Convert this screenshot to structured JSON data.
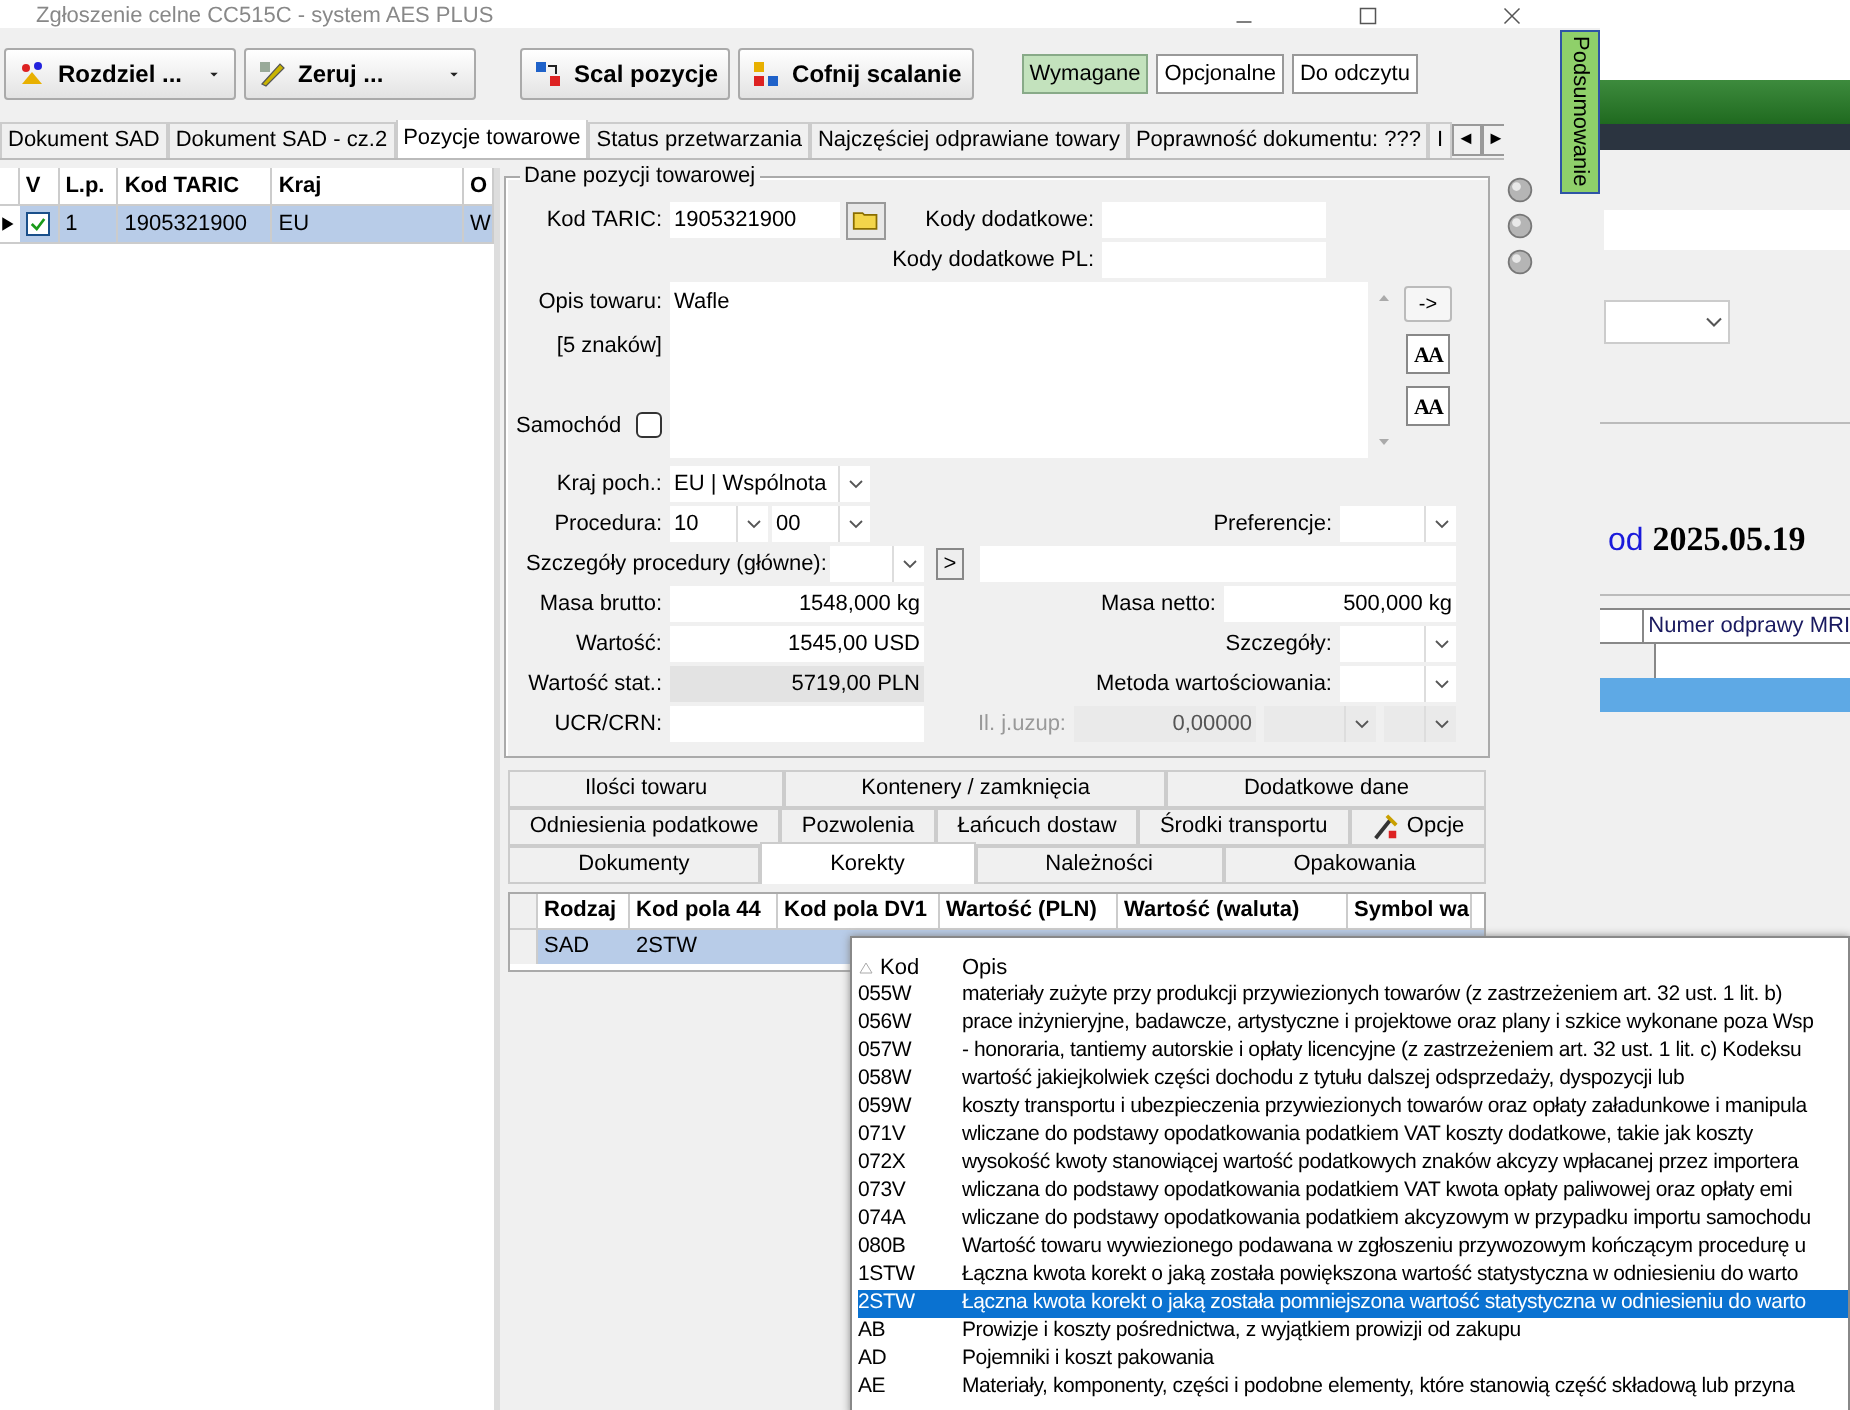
{
  "window": {
    "title": "Zgłoszenie celne CC515C - system AES PLUS"
  },
  "toolbar": {
    "buttons": [
      {
        "label": "Rozdziel ...",
        "kind": "split"
      },
      {
        "label": "Zeruj ...",
        "kind": "split"
      },
      {
        "label": "Scal pozycje",
        "kind": "plain"
      },
      {
        "label": "Cofnij scalanie",
        "kind": "plain"
      }
    ],
    "filters": [
      {
        "label": "Wymagane",
        "selected": true
      },
      {
        "label": "Opcjonalne",
        "selected": false
      },
      {
        "label": "Do odczytu",
        "selected": false
      }
    ]
  },
  "tabs": [
    {
      "label": "Dokument SAD",
      "selected": false
    },
    {
      "label": "Dokument SAD - cz.2",
      "selected": false
    },
    {
      "label": "Pozycje towarowe",
      "selected": true
    },
    {
      "label": "Status przetwarzania",
      "selected": false
    },
    {
      "label": "Najczęściej odprawiane towary",
      "selected": false
    },
    {
      "label": "Poprawność dokumentu: ???",
      "selected": false
    },
    {
      "label": "I",
      "selected": false
    }
  ],
  "tab_scroll": [
    "◄",
    "►"
  ],
  "items_table": {
    "check_column": "V",
    "columns": [
      "L.p.",
      "Kod TARIC",
      "Kraj",
      "O"
    ],
    "rows": [
      {
        "selected": true,
        "checked": true,
        "cells": [
          "1",
          "1905321900",
          "EU",
          "W"
        ]
      }
    ]
  },
  "form": {
    "title": "Dane pozycji towarowej",
    "kod_taric": {
      "label": "Kod TARIC:",
      "value": "1905321900"
    },
    "kody_dodatkowe": {
      "label": "Kody dodatkowe:"
    },
    "kody_dodatkowe_pl": {
      "label": "Kody dodatkowe PL:"
    },
    "opis": {
      "label": "Opis towaru:",
      "count": "[5 znaków]",
      "value": "Wafle"
    },
    "samochod": {
      "label": "Samochód",
      "checked": false
    },
    "side_buttons": [
      "->",
      "AA",
      "AA"
    ],
    "kraj": {
      "label": "Kraj poch.:",
      "value": "EU | Wspólnota"
    },
    "procedura": {
      "label": "Procedura:",
      "values": [
        "10",
        "00"
      ]
    },
    "preferencje": {
      "label": "Preferencje:"
    },
    "szczegoly_procedury": {
      "label": "Szczegóły procedury (główne):",
      "button": ">"
    },
    "masa_brutto": {
      "label": "Masa brutto:",
      "value": "1548,000 kg"
    },
    "masa_netto": {
      "label": "Masa netto:",
      "value": "500,000 kg"
    },
    "wartosc": {
      "label": "Wartość:",
      "value": "1545,00 USD"
    },
    "szczegoly": {
      "label": "Szczegóły:"
    },
    "wartosc_stat": {
      "label": "Wartość stat.:",
      "value": "5719,00 PLN"
    },
    "metoda": {
      "label": "Metoda wartościowania:"
    },
    "ucr": {
      "label": "UCR/CRN:"
    },
    "il_uzup": {
      "label": "Il. j.uzup:",
      "value": "0,00000",
      "disabled": true
    }
  },
  "bottom_tabs": [
    [
      {
        "label": "Ilości towaru",
        "selected": false
      },
      {
        "label": "Kontenery / zamknięcia",
        "selected": false
      },
      {
        "label": "Dodatkowe dane",
        "selected": false
      }
    ],
    [
      {
        "label": "Odniesienia podatkowe",
        "selected": false
      },
      {
        "label": "Pozwolenia",
        "selected": false
      },
      {
        "label": "Łańcuch dostaw",
        "selected": false
      },
      {
        "label": "Środki transportu",
        "selected": false
      },
      {
        "label": "Opcje",
        "selected": false,
        "icon": true
      }
    ],
    [
      {
        "label": "Dokumenty",
        "selected": false
      },
      {
        "label": "Korekty",
        "selected": true
      },
      {
        "label": "Należności",
        "selected": false
      },
      {
        "label": "Opakowania",
        "selected": false
      }
    ]
  ],
  "korekty_table": {
    "columns": [
      "Rodzaj",
      "Kod pola 44",
      "Kod pola DV1",
      "Wartość (PLN)",
      "Wartość (waluta)",
      "Symbol wa"
    ],
    "rows": [
      {
        "selected": true,
        "cells": [
          "SAD",
          "2STW"
        ]
      }
    ]
  },
  "side_tab": "Podsumowanie",
  "background_window": {
    "date_text": "od **2025.05.19**",
    "table_column": "Numer odprawy MRI"
  },
  "code_list": {
    "columns": [
      "Kod",
      "Opis"
    ],
    "rows": [
      {
        "code": "055W",
        "text": "materiały zużyte przy produkcji przywiezionych towarów (z zastrzeżeniem art. 32 ust. 1 lit. b)",
        "selected": false
      },
      {
        "code": "056W",
        "text": "prace inżynieryjne, badawcze, artystyczne i projektowe oraz plany i szkice wykonane poza Wsp",
        "selected": false
      },
      {
        "code": "057W",
        "text": "- honoraria, tantiemy autorskie i opłaty licencyjne (z zastrzeżeniem art. 32 ust. 1 lit. c) Kodeksu",
        "selected": false
      },
      {
        "code": "058W",
        "text": "wartość jakiejkolwiek części dochodu z tytułu dalszej odsprzedaży, dyspozycji lub",
        "selected": false
      },
      {
        "code": "059W",
        "text": "koszty transportu i ubezpieczenia przywiezionych towarów oraz opłaty załadunkowe i manipula",
        "selected": false
      },
      {
        "code": "071V",
        "text": "wliczane do podstawy opodatkowania podatkiem VAT koszty dodatkowe, takie jak koszty",
        "selected": false
      },
      {
        "code": "072X",
        "text": "wysokość kwoty stanowiącej wartość podatkowych znaków akcyzy wpłacanej przez importera",
        "selected": false
      },
      {
        "code": "073V",
        "text": "wliczana do podstawy opodatkowania podatkiem VAT kwota opłaty paliwowej oraz opłaty emi",
        "selected": false
      },
      {
        "code": "074A",
        "text": "wliczane do podstawy opodatkowania podatkiem akcyzowym w przypadku importu samochodu",
        "selected": false
      },
      {
        "code": "080B",
        "text": "Wartość towaru wywiezionego podawana w zgłoszeniu przywozowym kończącym procedurę u",
        "selected": false
      },
      {
        "code": "1STW",
        "text": "Łączna kwota korekt o jaką została powiększona wartość statystyczna w odniesieniu do warto",
        "selected": false
      },
      {
        "code": "2STW",
        "text": "Łączna kwota korekt o jaką została pomniejszona wartość statystyczna w odniesieniu do warto",
        "selected": true
      },
      {
        "code": "AB",
        "text": "Prowizje i koszty pośrednictwa, z wyjątkiem prowizji od zakupu",
        "selected": false
      },
      {
        "code": "AD",
        "text": "Pojemniki i koszt pakowania",
        "selected": false
      },
      {
        "code": "AE",
        "text": "Materiały, komponenty, części i podobne elementy, które stanowią część składową lub przyna",
        "selected": false
      }
    ]
  }
}
